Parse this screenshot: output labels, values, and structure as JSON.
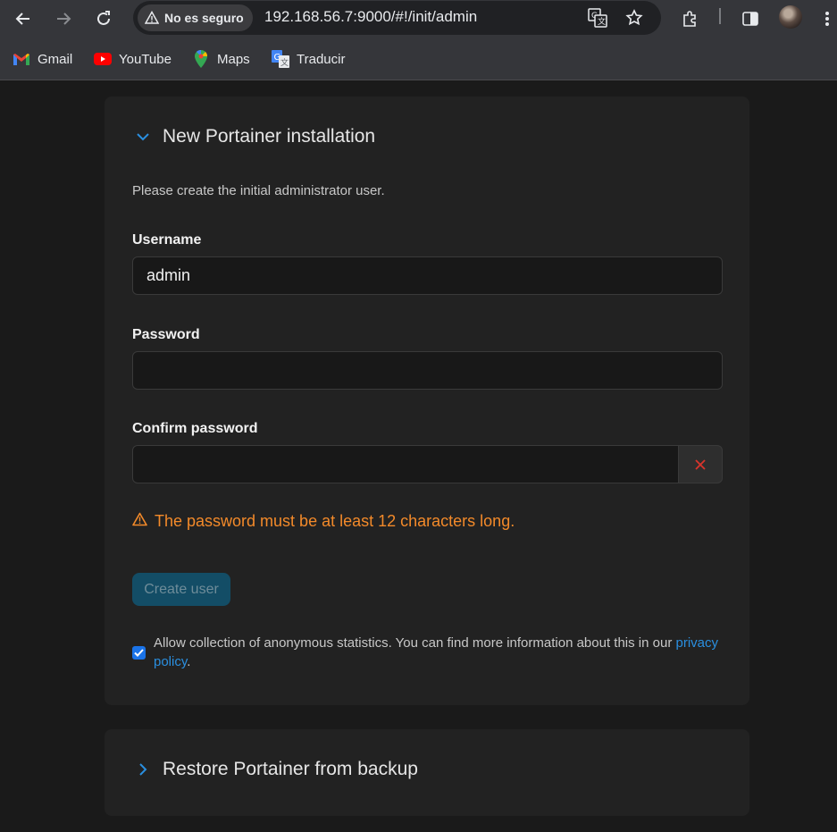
{
  "browser": {
    "security_label": "No es seguro",
    "url": "192.168.56.7:9000/#!/init/admin",
    "bookmarks": [
      {
        "label": "Gmail",
        "icon": "gmail-icon"
      },
      {
        "label": "YouTube",
        "icon": "youtube-icon"
      },
      {
        "label": "Maps",
        "icon": "maps-icon"
      },
      {
        "label": "Traducir",
        "icon": "translate-icon"
      }
    ]
  },
  "install": {
    "title": "New Portainer installation",
    "intro": "Please create the initial administrator user.",
    "username_label": "Username",
    "username_value": "admin",
    "password_label": "Password",
    "password_value": "",
    "confirm_label": "Confirm password",
    "confirm_value": "",
    "warning": "The password must be at least 12 characters long.",
    "create_button": "Create user",
    "stats_checked": true,
    "stats_text": "Allow collection of anonymous statistics. You can find more information about this in our ",
    "privacy_link": "privacy policy",
    "stats_suffix": "."
  },
  "restore": {
    "title": "Restore Portainer from backup"
  },
  "colors": {
    "accent": "#1a73e8",
    "warning": "#f38a2a",
    "error": "#d9342b",
    "link": "#2a8fe0"
  }
}
